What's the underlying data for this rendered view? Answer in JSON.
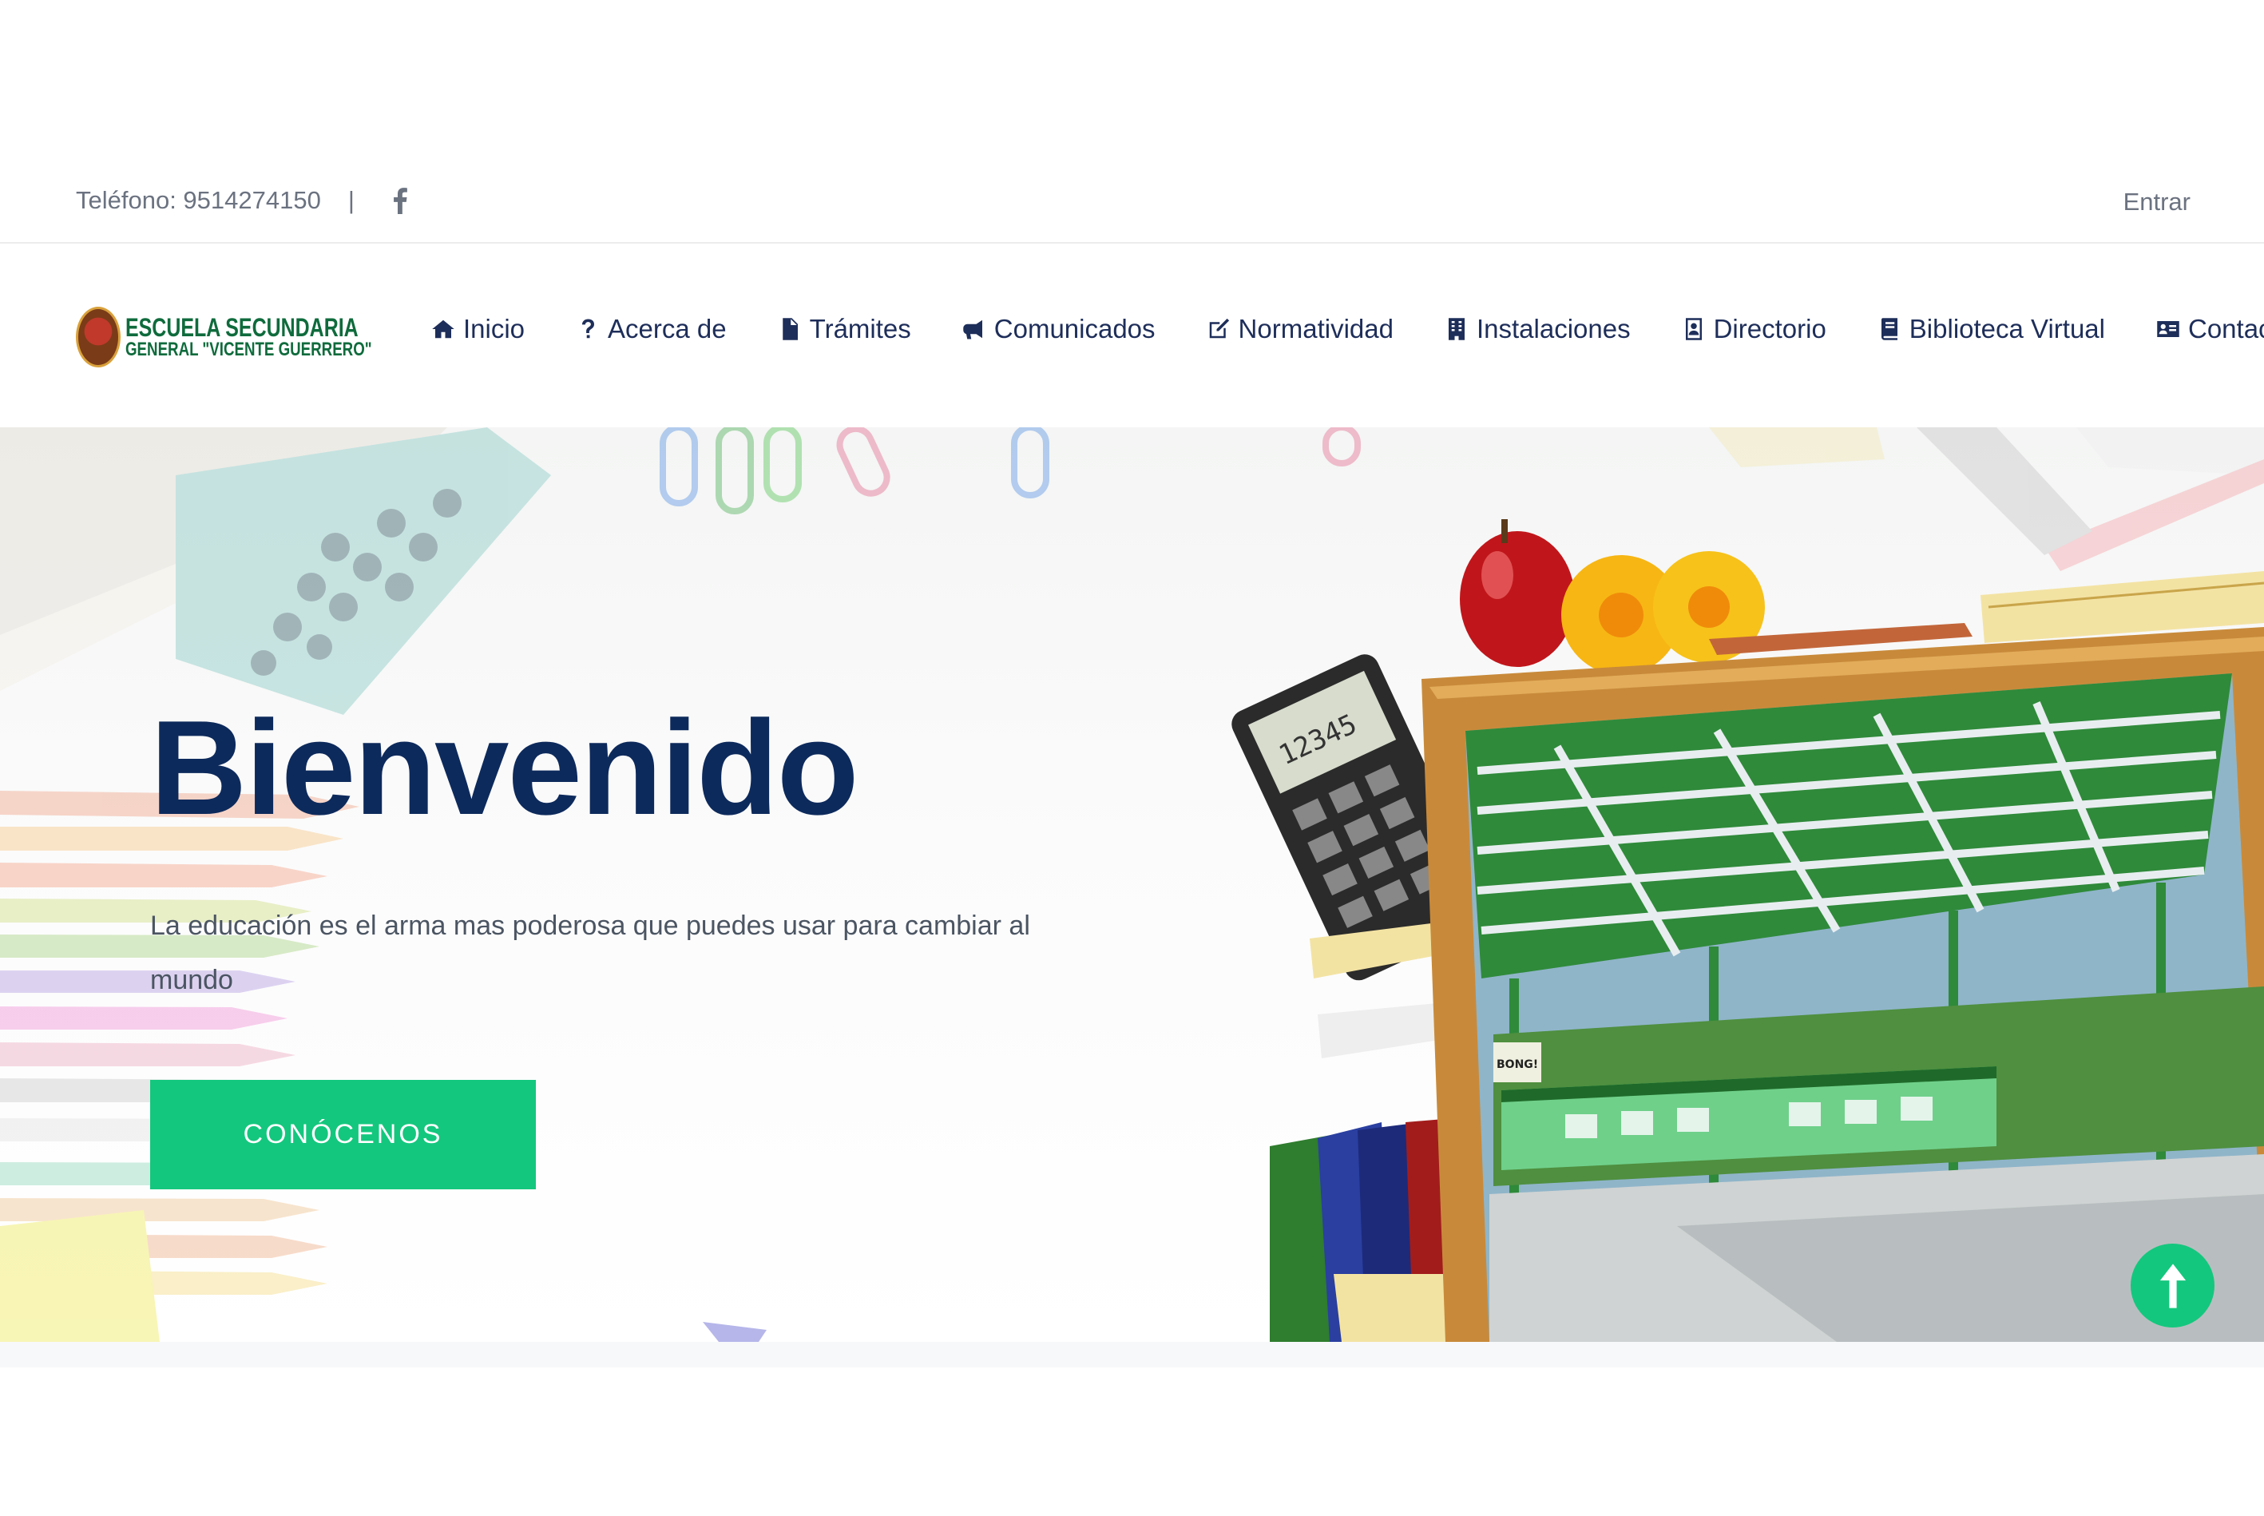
{
  "topbar": {
    "phone": "Teléfono: 9514274150",
    "separator": "|",
    "social_icon": "facebook-icon",
    "login_label": "Entrar"
  },
  "logo": {
    "line1": "ESCUELA SECUNDARIA",
    "line2": "GENERAL \"VICENTE GUERRERO\""
  },
  "nav": {
    "items": [
      {
        "label": "Inicio",
        "icon": "home-icon"
      },
      {
        "label": "Acerca de",
        "icon": "question-icon"
      },
      {
        "label": "Trámites",
        "icon": "document-icon"
      },
      {
        "label": "Comunicados",
        "icon": "megaphone-icon"
      },
      {
        "label": "Normatividad",
        "icon": "edit-icon"
      },
      {
        "label": "Instalaciones",
        "icon": "building-icon"
      },
      {
        "label": "Directorio",
        "icon": "contact-book-icon"
      },
      {
        "label": "Biblioteca Virtual",
        "icon": "book-icon"
      },
      {
        "label": "Contacto",
        "icon": "id-card-icon"
      }
    ]
  },
  "hero": {
    "title": "Bienvenido",
    "subtitle": "La educación es el arma mas poderosa que puedes usar para cambiar al mundo",
    "button_label": "CONÓCENOS",
    "calculator_display": "12345",
    "sign_text": "BONG!"
  },
  "colors": {
    "primary": "#14c77e",
    "navy": "#0d2a5c",
    "nav_text": "#1e2e5a",
    "muted_text": "#6b7280"
  }
}
